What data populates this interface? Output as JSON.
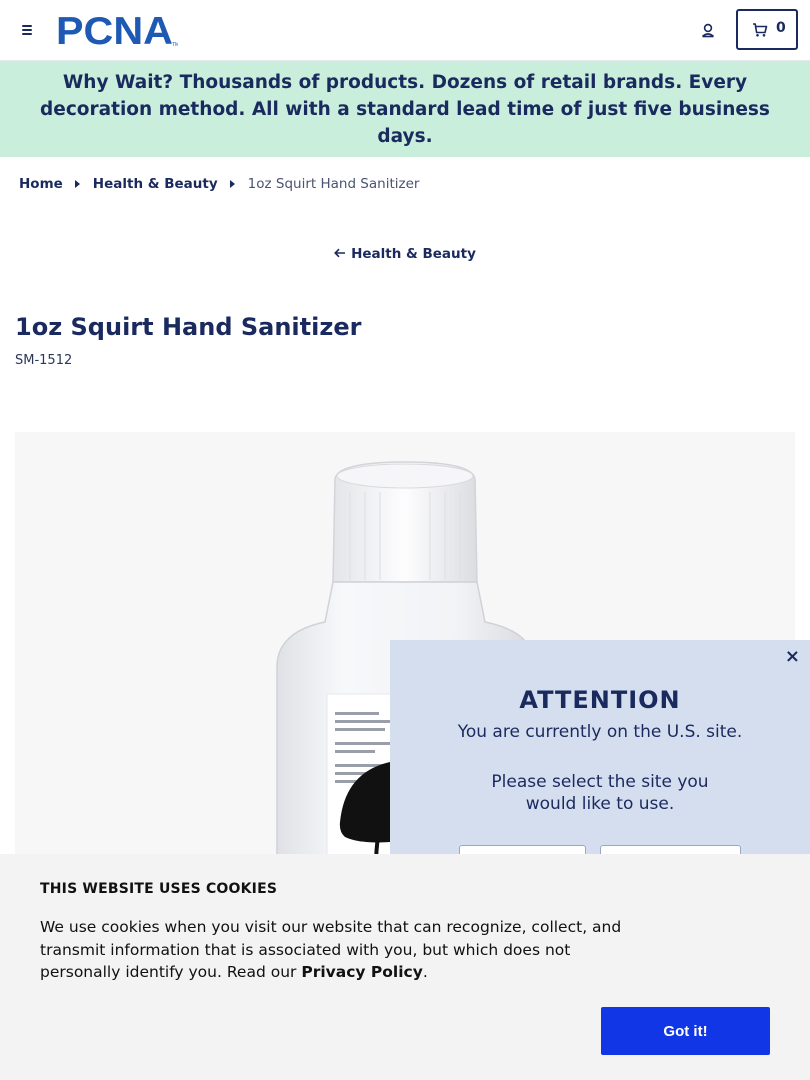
{
  "header": {
    "logo_text": "PCNA",
    "cart_count": "0"
  },
  "promo": {
    "lead": "Why Wait?",
    "text": " Thousands of products. Dozens of retail brands. Every decoration method. All with a standard lead time of just five business days."
  },
  "breadcrumb": {
    "items": [
      "Home",
      "Health & Beauty"
    ],
    "current": "1oz Squirt Hand Sanitizer"
  },
  "back_link": "Health & Beauty",
  "product": {
    "title": "1oz Squirt Hand Sanitizer",
    "sku": "SM-1512"
  },
  "site_popup": {
    "close": "×",
    "title": "ATTENTION",
    "line1": "You are currently on the U.S. site.",
    "line2": "Please select the site you would like to use."
  },
  "cookie": {
    "title": "THIS WEBSITE USES COOKIES",
    "text": "We use cookies when you visit our website that can recognize, collect, and transmit information that is associated with you, but which does not personally identify you. Read our ",
    "link": "Privacy Policy",
    "text_end": ".",
    "button": "Got it!"
  },
  "colors": {
    "navy": "#1a2a5e",
    "brand_blue": "#1e5ab4",
    "promo_bg": "#c9eedb",
    "popup_bg": "#d4deef",
    "cookie_button": "#1136e6"
  }
}
